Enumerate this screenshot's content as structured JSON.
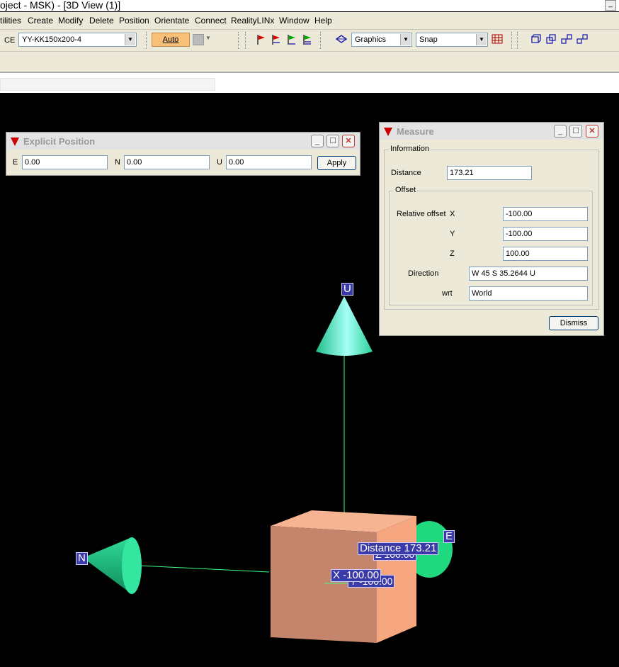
{
  "window": {
    "title": "oject - MSK) - [3D View (1)]"
  },
  "menu": [
    "tilities",
    "Create",
    "Modify",
    "Delete",
    "Position",
    "Orientate",
    "Connect",
    "RealityLINx",
    "Window",
    "Help"
  ],
  "toolbar": {
    "ce_label": "CE",
    "ce_value": "YY-KK150x200-4",
    "auto_label": "Auto",
    "graphics_value": "Graphics",
    "snap_value": "Snap"
  },
  "explicit_position": {
    "title": "Explicit Position",
    "e_label": "E",
    "e_value": "0.00",
    "n_label": "N",
    "n_value": "0.00",
    "u_label": "U",
    "u_value": "0.00",
    "apply_label": "Apply"
  },
  "measure": {
    "title": "Measure",
    "info_group": "Information",
    "distance_label": "Distance",
    "distance_value": "173.21",
    "offset_group": "Offset",
    "relative_offset_label": "Relative offset",
    "x_label": "X",
    "x_value": "-100.00",
    "y_label": "Y",
    "y_value": "-100.00",
    "z_label": "Z",
    "z_value": "100.00",
    "direction_label": "Direction",
    "direction_value": "W 45 S 35.2644 U",
    "wrt_label": "wrt",
    "wrt_value": "World",
    "dismiss_label": "Dismiss"
  },
  "scene": {
    "axis_u": "U",
    "axis_n": "N",
    "axis_e": "E",
    "distance_tag": "Distance 173.21",
    "z_tag": "Z 100.00",
    "x_tag": "X -100.00",
    "y_tag": "Y -100.00"
  },
  "colors": {
    "viewport": "#000000",
    "cone": "#40e0a0",
    "box": "#f3a584",
    "tag": "#3a3aa8"
  }
}
